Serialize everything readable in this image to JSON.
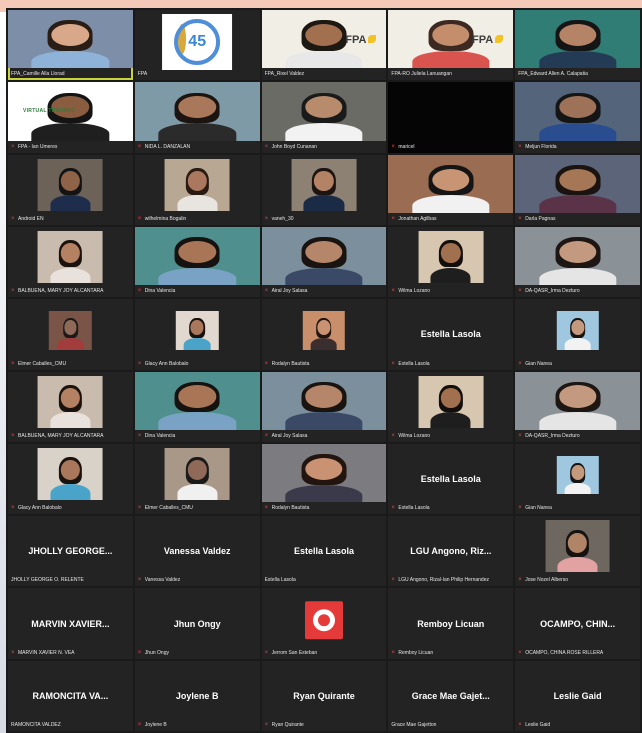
{
  "meeting": {
    "colors": {
      "tile_bg": "#232323",
      "active_speaker_border": "#c8d43a",
      "muted_mic": "#e34848",
      "name_text": "#e6e6e6"
    },
    "muted_icon": "mic-off-icon",
    "tiles": [
      {
        "name": "FPA_Camille Alla Llorad",
        "muted": false,
        "type": "video",
        "active": true,
        "bg": "#7d8fa8",
        "skin": "#d9a88a",
        "shirt": "#8fb3d8",
        "hair": "#2a1d15"
      },
      {
        "name": "FPA",
        "muted": false,
        "type": "logo45"
      },
      {
        "name": "FPA_Rixel Valdez",
        "muted": false,
        "type": "fpa_video",
        "bg": "#f1eee5",
        "skin": "#a2704f",
        "shirt": "#e8e8e8",
        "hair": "#1e1812"
      },
      {
        "name": "FPA-RO Juliela Lanuangan",
        "muted": false,
        "type": "fpa_video",
        "bg": "#f1eee5",
        "skin": "#c48e6d",
        "shirt": "#d9534f",
        "hair": "#3c2a22"
      },
      {
        "name": "FPA_Edward Allen A. Calapatia",
        "muted": false,
        "type": "video",
        "bg": "#2f7d74",
        "skin": "#b58366",
        "shirt": "#243b55",
        "hair": "#151515"
      },
      {
        "name": "FPA - Ian Umeres",
        "muted": true,
        "type": "virtual_video",
        "bg": "#ffffff",
        "skin": "#8a5d40",
        "shirt": "#1f1f1f",
        "hair": "#141414"
      },
      {
        "name": "NIDA L. DANZALAN",
        "muted": true,
        "type": "video",
        "bg": "#7e9aa6",
        "skin": "#a9785a",
        "shirt": "#2b2b2b",
        "hair": "#1b1410"
      },
      {
        "name": "John Boyd Cunanan",
        "muted": true,
        "type": "video",
        "bg": "#6b6b66",
        "skin": "#b78b6b",
        "shirt": "#f2f2f2",
        "hair": "#1a1a1a"
      },
      {
        "name": "maricel",
        "muted": true,
        "type": "black"
      },
      {
        "name": "Meljun Florida",
        "muted": true,
        "type": "video",
        "bg": "#53647b",
        "skin": "#9e7258",
        "shirt": "#2a4d8f",
        "hair": "#151515"
      },
      {
        "name": "Android EN",
        "muted": true,
        "type": "video_center",
        "bg": "#6c6258",
        "skin": "#8f6347",
        "shirt": "#1f2d4d",
        "hair": "#141414"
      },
      {
        "name": "wilhelmina Bogalin",
        "muted": true,
        "type": "video_center",
        "bg": "#b8a793",
        "skin": "#a9785e",
        "shirt": "#e8e4df",
        "hair": "#2a1a12"
      },
      {
        "name": "vaneh_30",
        "muted": true,
        "type": "video_center",
        "bg": "#8c8172",
        "skin": "#b48365",
        "shirt": "#1b2a45",
        "hair": "#1c1410"
      },
      {
        "name": "Jonathan Agilbas",
        "muted": true,
        "type": "video",
        "bg": "#9a6c52",
        "skin": "#c79574",
        "shirt": "#f1f1f1",
        "hair": "#151515"
      },
      {
        "name": "Darla Pagnas",
        "muted": true,
        "type": "video",
        "bg": "#5b6478",
        "skin": "#a57757",
        "shirt": "#5a3348",
        "hair": "#1a1310"
      },
      {
        "name": "BALBUENA, MARY JOY ALCANTARA",
        "muted": true,
        "type": "video_center",
        "bg": "#c9bcae",
        "skin": "#b48263",
        "shirt": "#e9e2dc",
        "hair": "#1b120e"
      },
      {
        "name": "Dina Valencia",
        "muted": true,
        "type": "video",
        "bg": "#4f8f8d",
        "skin": "#a87557",
        "shirt": "#7aa2c4",
        "hair": "#151210"
      },
      {
        "name": "Airal Joy Salasa",
        "muted": true,
        "type": "video",
        "bg": "#7b8f9c",
        "skin": "#b6866a",
        "shirt": "#3a4a66",
        "hair": "#1a1410"
      },
      {
        "name": "Wilma Lozano",
        "muted": true,
        "type": "video_center",
        "bg": "#d7c7b1",
        "skin": "#a0704f",
        "shirt": "#1e1e1e",
        "hair": "#120e0b"
      },
      {
        "name": "DA-QASR_Irma Dezturo",
        "muted": true,
        "type": "video",
        "bg": "#8a9298",
        "skin": "#c39a80",
        "shirt": "#e5e5e5",
        "hair": "#1e1612"
      },
      {
        "name": "Elmer Caballes_CMU",
        "muted": true,
        "type": "video_small",
        "bg": "#7a5446",
        "skin": "#8f6a58",
        "shirt": "#a33c3c",
        "hair": "#1a1a1a"
      },
      {
        "name": "Glacy Ann Balobalo",
        "muted": true,
        "type": "video_small",
        "bg": "#e1d9cf",
        "skin": "#a9785c",
        "shirt": "#4aa3c9",
        "hair": "#1a120f"
      },
      {
        "name": "Rodalyn Bautista",
        "muted": true,
        "type": "video_small",
        "bg": "#c98f6a",
        "skin": "#c99273",
        "shirt": "#3a2e2e",
        "hair": "#22150f"
      },
      {
        "name": "Estella Lasola",
        "muted": true,
        "type": "name",
        "display_name": "Estella Lasola"
      },
      {
        "name": "Gian Nanea",
        "muted": true,
        "type": "video_small",
        "bg": "#9fc7e0",
        "skin": "#c59a7c",
        "shirt": "#f2f2f2",
        "hair": "#151515"
      },
      {
        "name": "BALBUENA, MARY JOY ALCANTARA",
        "muted": true,
        "type": "video_center",
        "bg": "#c9bcae",
        "skin": "#b48263",
        "shirt": "#e9e2dc",
        "hair": "#1b120e"
      },
      {
        "name": "Dina Valencia",
        "muted": true,
        "type": "video",
        "bg": "#4f8f8d",
        "skin": "#a87557",
        "shirt": "#7aa2c4",
        "hair": "#151210"
      },
      {
        "name": "Airal Joy Salasa",
        "muted": true,
        "type": "video",
        "bg": "#7b8f9c",
        "skin": "#b6866a",
        "shirt": "#3a4a66",
        "hair": "#1a1410"
      },
      {
        "name": "Wilma Lozano",
        "muted": true,
        "type": "video_center",
        "bg": "#d7c7b1",
        "skin": "#a0704f",
        "shirt": "#1e1e1e",
        "hair": "#120e0b"
      },
      {
        "name": "DA-QASR_Irma Dezturo",
        "muted": true,
        "type": "video",
        "bg": "#8a9298",
        "skin": "#c39a80",
        "shirt": "#e5e5e5",
        "hair": "#1e1612"
      },
      {
        "name": "Glacy Ann Balobalo",
        "muted": true,
        "type": "video_center",
        "bg": "#d9d2c8",
        "skin": "#a9785c",
        "shirt": "#4aa3c9",
        "hair": "#1a120f"
      },
      {
        "name": "Elmer Caballes_CMU",
        "muted": true,
        "type": "video_center",
        "bg": "#a99887",
        "skin": "#8f6a58",
        "shirt": "#f0f0f0",
        "hair": "#1a1a1a"
      },
      {
        "name": "Rodalyn Bautista",
        "muted": true,
        "type": "video",
        "bg": "#7c7b80",
        "skin": "#c99273",
        "shirt": "#3a3a4a",
        "hair": "#22150f"
      },
      {
        "name": "Estella Lasola",
        "muted": true,
        "type": "name",
        "display_name": "Estella Lasola"
      },
      {
        "name": "Gian Nanea",
        "muted": true,
        "type": "video_small",
        "bg": "#9fc7e0",
        "skin": "#c59a7c",
        "shirt": "#f2f2f2",
        "hair": "#151515"
      },
      {
        "name": "JHOLLY GEORGE O. RELENTE",
        "muted": false,
        "type": "name",
        "display_name": "JHOLLY GEORGE..."
      },
      {
        "name": "Vanessa Valdez",
        "muted": true,
        "type": "name",
        "display_name": "Vanessa Valdez"
      },
      {
        "name": "Estella Lasola",
        "muted": false,
        "type": "name",
        "display_name": "Estella Lasola"
      },
      {
        "name": "LGU Angono, Rizal-Ian Philip Hernandez",
        "muted": true,
        "type": "name",
        "display_name": "LGU Angono, Riz..."
      },
      {
        "name": "Jose Nozel Alberso",
        "muted": true,
        "type": "video_center",
        "bg": "#6d675f",
        "skin": "#b08466",
        "shirt": "#e2a2a2",
        "hair": "#161210"
      },
      {
        "name": "MARVIN XAVIER N. VEA",
        "muted": true,
        "type": "name",
        "display_name": "MARVIN XAVIER..."
      },
      {
        "name": "Jhun Ongy",
        "muted": true,
        "type": "name",
        "display_name": "Jhun Ongy"
      },
      {
        "name": "Jerrom San Esteban",
        "muted": true,
        "type": "red_logo"
      },
      {
        "name": "Remboy Licuan",
        "muted": true,
        "type": "name",
        "display_name": "Remboy Licuan"
      },
      {
        "name": "OCAMPO, CHINA ROSE RILLERA",
        "muted": true,
        "type": "name",
        "display_name": "OCAMPO, CHIN..."
      },
      {
        "name": "RAMONCITA VALDEZ",
        "muted": false,
        "type": "name",
        "display_name": "RAMONCITA VA..."
      },
      {
        "name": "Joylene B",
        "muted": true,
        "type": "name",
        "display_name": "Joylene B"
      },
      {
        "name": "Ryan Quirante",
        "muted": true,
        "type": "name",
        "display_name": "Ryan Quirante"
      },
      {
        "name": "Grace Mae Gajetton",
        "muted": false,
        "type": "name",
        "display_name": "Grace Mae Gajet..."
      },
      {
        "name": "Leslie Gaid",
        "muted": true,
        "type": "name",
        "display_name": "Leslie Gaid"
      }
    ],
    "logo45_text": "45",
    "fpa_text": "FPA",
    "virtual_text": "VIRTUAL TRAINING"
  }
}
